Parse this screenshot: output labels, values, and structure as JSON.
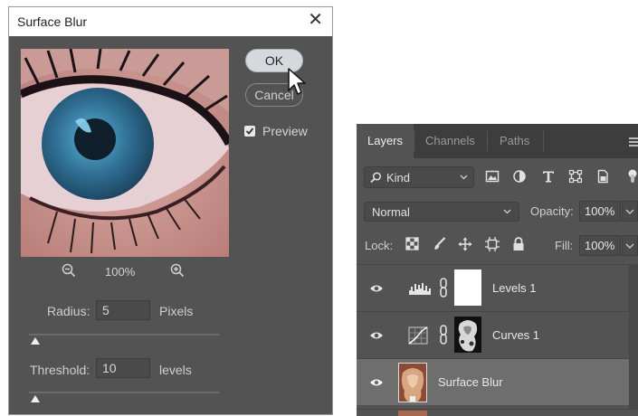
{
  "dialog": {
    "title": "Surface Blur",
    "ok_label": "OK",
    "cancel_label": "Cancel",
    "preview_label": "Preview",
    "preview_checked": true,
    "zoom_level": "100%",
    "radius": {
      "label": "Radius:",
      "value": "5",
      "unit": "Pixels",
      "slider_fraction": 0.01
    },
    "threshold": {
      "label": "Threshold:",
      "value": "10",
      "unit": "levels",
      "slider_fraction": 0.01
    }
  },
  "layers_panel": {
    "tabs": [
      "Layers",
      "Channels",
      "Paths"
    ],
    "active_tab": "Layers",
    "filter_kind": "Kind",
    "blend_mode": "Normal",
    "opacity_label": "Opacity:",
    "opacity_value": "100%",
    "lock_label": "Lock:",
    "fill_label": "Fill:",
    "fill_value": "100%",
    "layers": [
      {
        "name": "Levels 1",
        "type": "adjustment-levels",
        "visible": true
      },
      {
        "name": "Curves 1",
        "type": "adjustment-curves",
        "visible": true
      },
      {
        "name": "Surface Blur",
        "type": "smart-object",
        "visible": true,
        "selected": true
      }
    ]
  },
  "colors": {
    "dialog_bg": "#535353",
    "panel_bg": "#535353",
    "tab_bar_bg": "#3d3d3d",
    "selected_row": "#6e6e6e"
  }
}
